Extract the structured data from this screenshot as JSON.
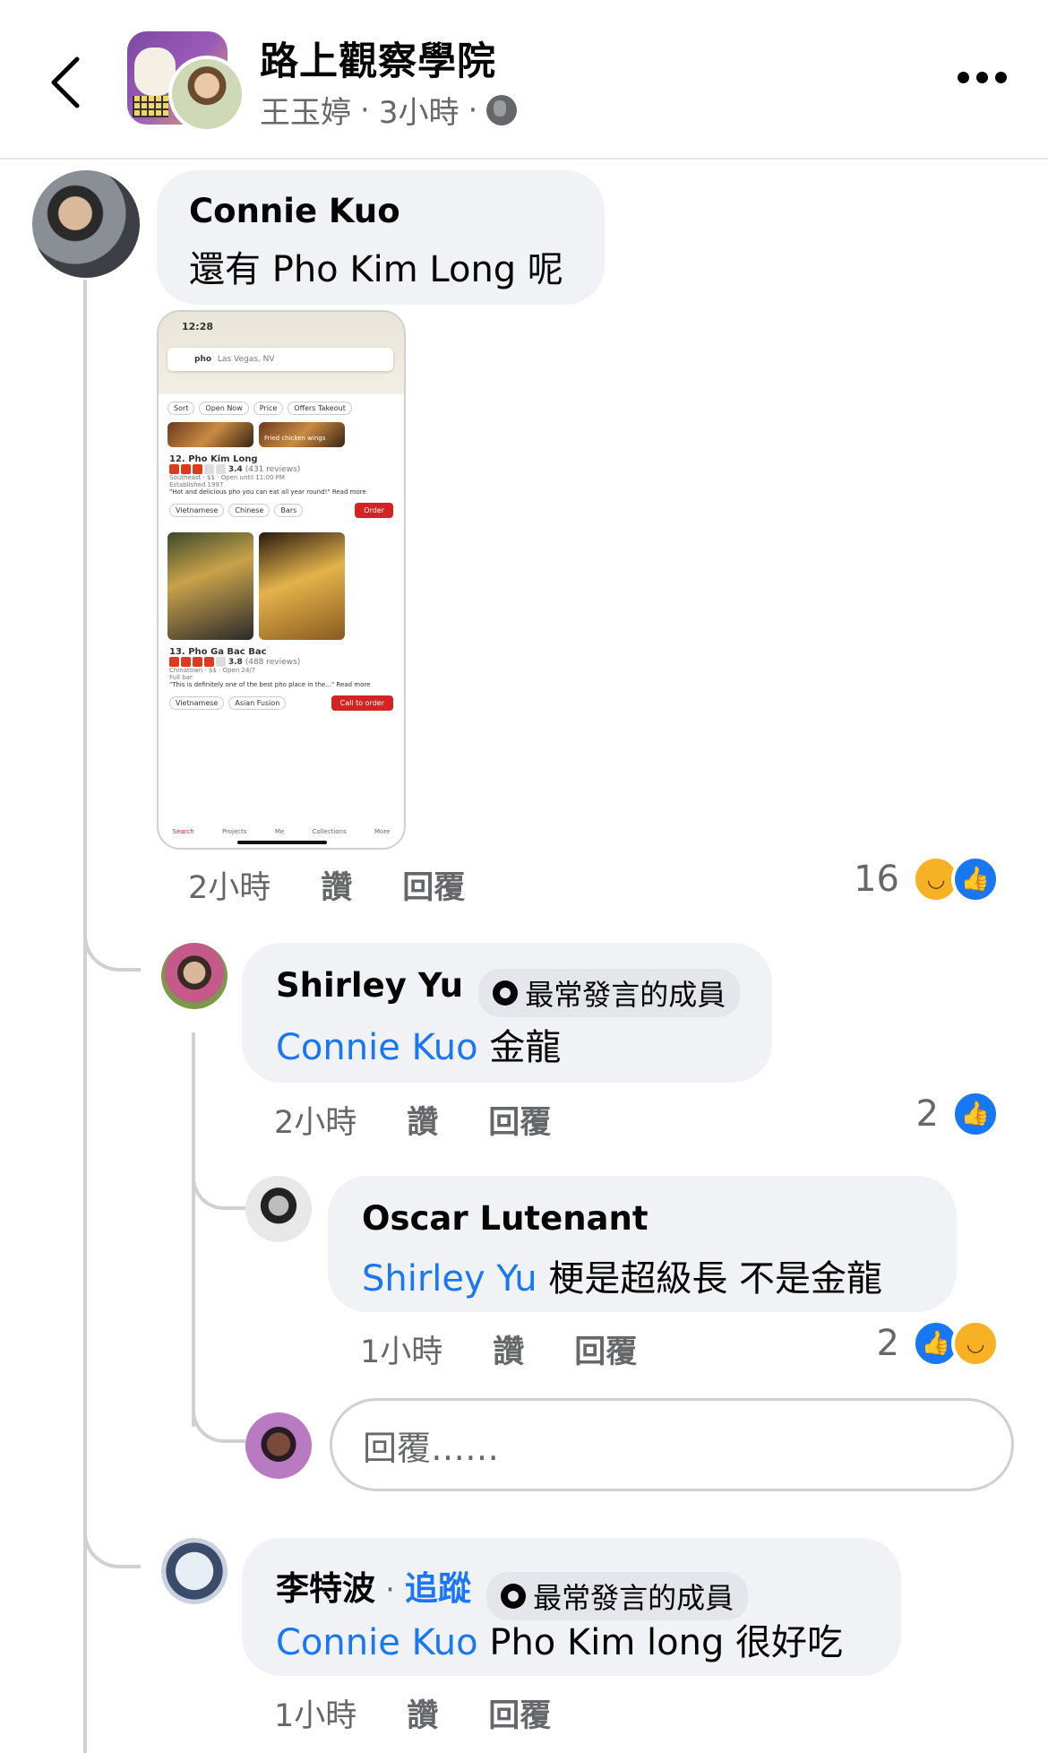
{
  "header": {
    "group_name": "路上觀察學院",
    "author": "王玉婷",
    "time": "3小時",
    "separator": "·",
    "visibility_icon": "globe-icon",
    "back_icon": "chevron-left-icon",
    "more_icon": "more-dots-icon"
  },
  "comments": [
    {
      "name": "Connie Kuo",
      "text": "還有 Pho Kim Long 呢",
      "time": "2小時",
      "like_label": "讚",
      "reply_label": "回覆",
      "reaction_count": "16",
      "reactions": [
        "haha",
        "like"
      ]
    },
    {
      "name": "Shirley Yu",
      "badge": "最常發言的成員",
      "mention": "Connie Kuo",
      "text": "金龍",
      "time": "2小時",
      "like_label": "讚",
      "reply_label": "回覆",
      "reaction_count": "2",
      "reactions": [
        "like"
      ]
    },
    {
      "name": "Oscar Lutenant",
      "mention": "Shirley Yu",
      "text": "梗是超級長 不是金龍",
      "time": "1小時",
      "like_label": "讚",
      "reply_label": "回覆",
      "reaction_count": "2",
      "reactions": [
        "like",
        "haha"
      ]
    },
    {
      "name": "李特波",
      "follow_label": "追蹤",
      "badge": "最常發言的成員",
      "mention": "Connie Kuo",
      "text": "Pho Kim long 很好吃",
      "time": "1小時",
      "like_label": "讚",
      "reply_label": "回覆"
    }
  ],
  "reply_input": {
    "placeholder": "回覆……"
  },
  "screenshot": {
    "status_time": "12:28",
    "search_term": "pho",
    "search_location": "Las Vegas, NV",
    "filters": [
      "Sort",
      "Open Now",
      "Price",
      "Offers Takeout"
    ],
    "photo_caption": "Fried chicken wings",
    "results": [
      {
        "title": "12. Pho Kim Long",
        "rating": "3.4",
        "reviews": "(431 reviews)",
        "location": "Southeast · $$ · Open until 11:00 PM",
        "extra": "Established 1997",
        "quote": "\"Hot and delicious pho you can eat all year round!\" Read more",
        "tags": [
          "Vietnamese",
          "Chinese",
          "Bars"
        ],
        "action": "Order"
      },
      {
        "title": "13. Pho Ga Bac Bac",
        "rating": "3.8",
        "reviews": "(488 reviews)",
        "location": "Chinatown · $$ · Open 24/7",
        "extra": "Full bar",
        "quote": "\"This is definitely one of the best pho place in the...\" Read more",
        "tags": [
          "Vietnamese",
          "Asian Fusion"
        ],
        "action": "Call to order"
      }
    ],
    "tabs": [
      "Search",
      "Projects",
      "Me",
      "Collections",
      "More"
    ]
  }
}
